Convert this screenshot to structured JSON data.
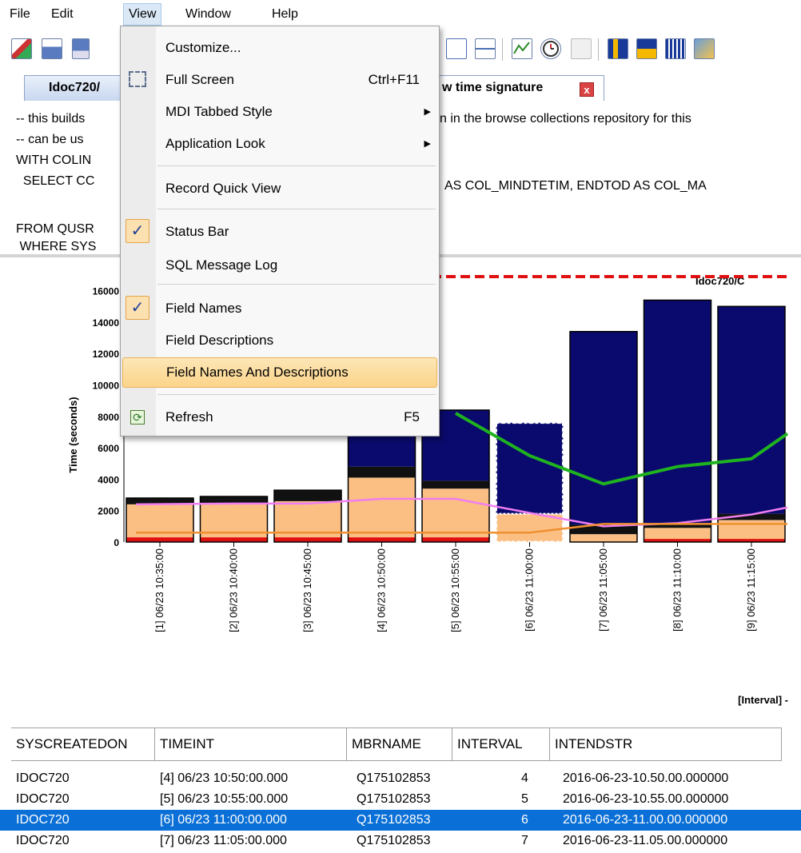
{
  "menubar": {
    "items": [
      "File",
      "Edit",
      "View",
      "Window",
      "Help"
    ],
    "active": "View"
  },
  "tabs": [
    {
      "label": "Idoc720/"
    },
    {
      "label": "w time signature",
      "close": "x"
    }
  ],
  "sql": {
    "lines": [
      "-- this builds",
      "-- can be us",
      "WITH COLIN",
      "  SELECT CC",
      "",
      "FROM QUSR",
      " WHERE SYS"
    ],
    "right_fragments": [
      "n in the browse collections repository for this",
      "AS COL_MINDTETIM, ENDTOD AS COL_MA"
    ]
  },
  "view_menu": {
    "items": [
      {
        "label": "Customize...",
        "shortcut": "",
        "submenu": false,
        "checked": false
      },
      {
        "label": "Full Screen",
        "shortcut": "Ctrl+F11",
        "submenu": false,
        "checked": false
      },
      {
        "label": "MDI Tabbed Style",
        "shortcut": "",
        "submenu": true,
        "checked": false
      },
      {
        "label": "Application Look",
        "shortcut": "",
        "submenu": true,
        "checked": false
      },
      {
        "label": "Record Quick View",
        "shortcut": "",
        "submenu": false,
        "checked": false
      },
      {
        "label": "Status Bar",
        "shortcut": "",
        "submenu": false,
        "checked": true
      },
      {
        "label": "SQL Message Log",
        "shortcut": "",
        "submenu": false,
        "checked": false
      },
      {
        "label": "Field Names",
        "shortcut": "",
        "submenu": false,
        "checked": true
      },
      {
        "label": "Field Descriptions",
        "shortcut": "",
        "submenu": false,
        "checked": false
      },
      {
        "label": "Field Names And Descriptions",
        "shortcut": "",
        "submenu": false,
        "checked": false,
        "highlighted": true
      },
      {
        "label": "Refresh",
        "shortcut": "F5",
        "submenu": false,
        "checked": false
      }
    ],
    "check_glyph": "✓",
    "arrow_glyph": "▶"
  },
  "chart_data": {
    "type": "bar",
    "title": "Idoc720/C",
    "ylabel": "Time (seconds)",
    "xlabel": "[Interval] -",
    "ylim": [
      0,
      17000
    ],
    "yticks": [
      0,
      2000,
      4000,
      6000,
      8000,
      10000,
      12000,
      14000,
      16000
    ],
    "categories": [
      "[1] 06/23 10:35:00",
      "[2] 06/23 10:40:00",
      "[3] 06/23 10:45:00",
      "[4] 06/23 10:50:00",
      "[5] 06/23 10:55:00",
      "[6] 06/23 11:00:00",
      "[7] 06/23 11:05:00",
      "[8] 06/23 11:10:00",
      "[9] 06/23 11:15:00"
    ],
    "series": [
      {
        "values": [
          300,
          300,
          300,
          300,
          300,
          0,
          0,
          200,
          200
        ],
        "color": "#e01010"
      },
      {
        "values": [
          2100,
          2100,
          2300,
          3800,
          3100,
          1800,
          500,
          700,
          1200
        ],
        "color": "#fbbf84"
      },
      {
        "values": [
          400,
          500,
          700,
          700,
          500,
          0,
          600,
          300,
          400
        ],
        "color": "#111111"
      },
      {
        "values": [
          0,
          0,
          0,
          3200,
          4500,
          5800,
          12300,
          14200,
          13200
        ],
        "color": "#0a0a6e"
      }
    ],
    "overlays": [
      {
        "type": "line",
        "color": "#f07ef0",
        "values": [
          2400,
          2450,
          2450,
          2750,
          2750,
          1850,
          1000,
          1200,
          1750,
          2200
        ]
      },
      {
        "type": "line",
        "color": "#1fb31f",
        "values": [
          null,
          null,
          null,
          null,
          8200,
          5500,
          3700,
          4800,
          5300,
          6900
        ]
      },
      {
        "type": "line",
        "color": "#f09030",
        "values": [
          600,
          600,
          600,
          600,
          600,
          600,
          1150,
          1150,
          1150,
          1150
        ]
      },
      {
        "type": "hline",
        "color": "#e01010",
        "value": 16900,
        "dashed": true
      }
    ],
    "selected_index": 5
  },
  "grid": {
    "columns": [
      "SYSCREATEDON",
      "TIMEINT",
      "MBRNAME",
      "INTERVAL",
      "INTENDSTR"
    ],
    "rows": [
      [
        "IDOC720",
        "[4] 06/23 10:50:00.000",
        "Q175102853",
        "4",
        "2016-06-23-10.50.00.000000"
      ],
      [
        "IDOC720",
        "[5] 06/23 10:55:00.000",
        "Q175102853",
        "5",
        "2016-06-23-10.55.00.000000"
      ],
      [
        "IDOC720",
        "[6] 06/23 11:00:00.000",
        "Q175102853",
        "6",
        "2016-06-23-11.00.00.000000"
      ],
      [
        "IDOC720",
        "[7] 06/23 11:05:00.000",
        "Q175102853",
        "7",
        "2016-06-23-11.05.00.000000"
      ]
    ],
    "selected_row": 2
  },
  "colors": {
    "menu_highlight": "#fbd48a",
    "selection": "#0a6fd6",
    "tab_close": "#d94343"
  }
}
